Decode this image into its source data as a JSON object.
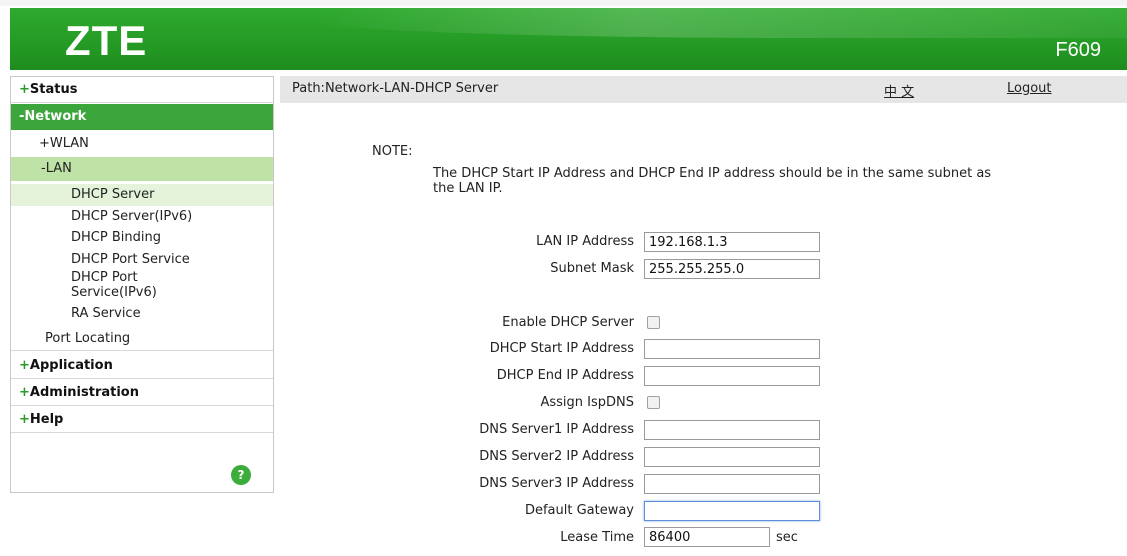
{
  "header": {
    "logo": "ZTE",
    "model": "F609"
  },
  "sidebar": {
    "status": {
      "sign": "+",
      "label": "Status"
    },
    "network": {
      "label": "-Network"
    },
    "wlan": {
      "label": "+WLAN"
    },
    "lan": {
      "label": "-LAN"
    },
    "lan_items": [
      "DHCP Server",
      "DHCP Server(IPv6)",
      "DHCP Binding",
      "DHCP Port Service",
      "DHCP Port Service(IPv6)",
      "RA Service"
    ],
    "port_locating": "Port Locating",
    "application": {
      "sign": "+",
      "label": "Application"
    },
    "administration": {
      "sign": "+",
      "label": "Administration"
    },
    "help": {
      "sign": "+",
      "label": "Help"
    },
    "help_icon": "?"
  },
  "pathbar": {
    "path": "Path:Network-LAN-DHCP Server",
    "lang": "中 文",
    "logout": "Logout"
  },
  "note": {
    "title": "NOTE:",
    "text": "The DHCP Start IP Address and DHCP End IP address should be in the same subnet as the LAN IP."
  },
  "form": {
    "lan_ip": {
      "label": "LAN IP Address",
      "value": "192.168.1.3"
    },
    "subnet_mask": {
      "label": "Subnet Mask",
      "value": "255.255.255.0"
    },
    "enable_dhcp": {
      "label": "Enable DHCP Server"
    },
    "dhcp_start": {
      "label": "DHCP Start IP Address",
      "value": ""
    },
    "dhcp_end": {
      "label": "DHCP End IP Address",
      "value": ""
    },
    "assign_isp_dns": {
      "label": "Assign IspDNS"
    },
    "dns1": {
      "label": "DNS Server1 IP Address",
      "value": ""
    },
    "dns2": {
      "label": "DNS Server2 IP Address",
      "value": ""
    },
    "dns3": {
      "label": "DNS Server3 IP Address",
      "value": ""
    },
    "gateway": {
      "label": "Default Gateway",
      "value": ""
    },
    "lease_time": {
      "label": "Lease Time",
      "value": "86400",
      "unit": "sec"
    }
  }
}
